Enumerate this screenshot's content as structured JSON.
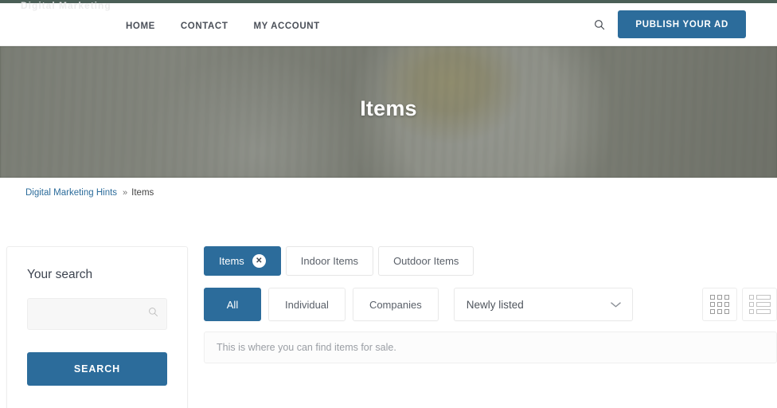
{
  "theme": {
    "accent": "#2c6c9b",
    "top_strip": "#4b5f57",
    "link": "#2c6c9b",
    "muted_text": "#9a9ea4"
  },
  "header": {
    "brand": "Digital Marketing",
    "nav": [
      {
        "label": "HOME"
      },
      {
        "label": "CONTACT"
      },
      {
        "label": "MY ACCOUNT"
      }
    ],
    "search_icon": "search-icon",
    "publish_label": "PUBLISH YOUR AD"
  },
  "hero": {
    "title": "Items"
  },
  "breadcrumb": {
    "root": "Digital Marketing Hints",
    "separator": "»",
    "current": "Items"
  },
  "sidebar": {
    "title": "Your search",
    "search": {
      "value": "",
      "placeholder": "",
      "icon": "magnifier-icon"
    },
    "submit_label": "SEARCH"
  },
  "main": {
    "tabs": [
      {
        "label": "Items",
        "active": true,
        "closable": true,
        "close_glyph": "✕"
      },
      {
        "label": "Indoor Items",
        "active": false,
        "closable": false
      },
      {
        "label": "Outdoor Items",
        "active": false,
        "closable": false
      }
    ],
    "segments": [
      {
        "label": "All",
        "active": true
      },
      {
        "label": "Individual",
        "active": false
      },
      {
        "label": "Companies",
        "active": false
      }
    ],
    "sort": {
      "selected": "Newly listed",
      "options": [
        "Newly listed"
      ],
      "chevron": "⌄"
    },
    "views": [
      {
        "name": "grid-view",
        "active": false
      },
      {
        "name": "list-view",
        "active": false
      }
    ],
    "info_text": "This is where you can find items for sale."
  }
}
